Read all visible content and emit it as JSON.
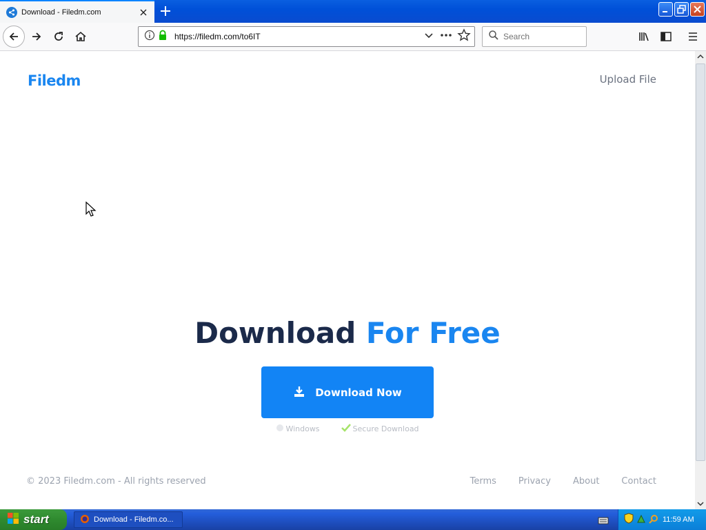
{
  "browser": {
    "tab_title": "Download - Filedm.com",
    "url": "https://filedm.com/to6IT",
    "search_placeholder": "Search"
  },
  "page": {
    "logo": "Filedm",
    "upload_link": "Upload File",
    "headline_part1": "Download",
    "headline_part2": "For Free",
    "download_button": "Download Now",
    "badge_windows": "Windows",
    "badge_secure": "Secure Download",
    "copyright": "© 2023 Filedm.com - All rights reserved",
    "footer_links": [
      "Terms",
      "Privacy",
      "About",
      "Contact"
    ]
  },
  "taskbar": {
    "start_label": "start",
    "task_item": "Download - Filedm.co...",
    "clock": "11:59 AM"
  },
  "colors": {
    "brand_blue": "#1a86f0",
    "button_blue": "#1284f5",
    "headline_dark": "#1b2a4a"
  }
}
